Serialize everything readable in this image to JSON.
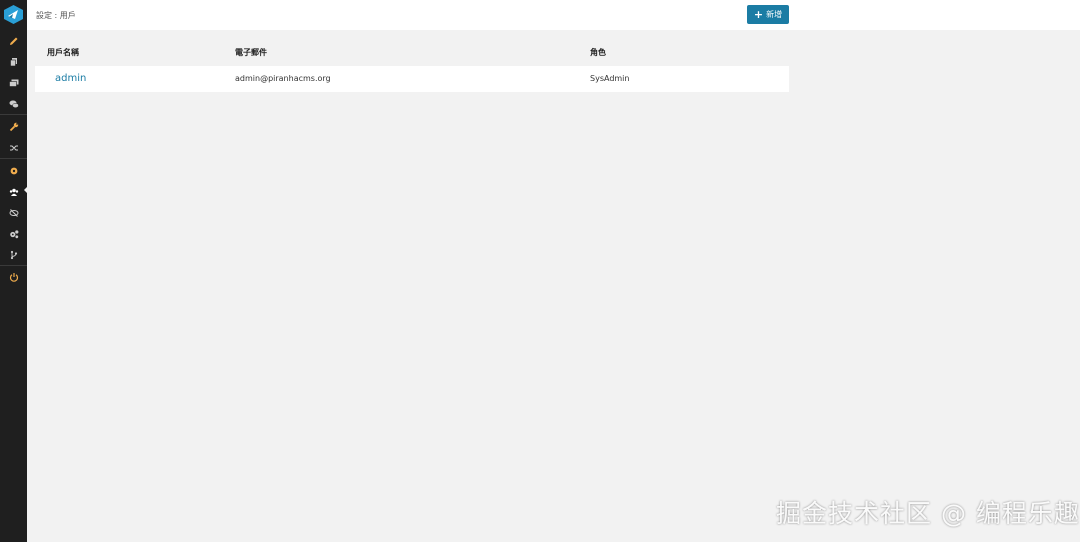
{
  "sidebar": {
    "logo_icon": "piranha-logo-icon",
    "items": [
      {
        "icon": "pencil-icon",
        "color": "#f0ad4e"
      },
      {
        "icon": "pages-icon",
        "color": "#cccccc"
      },
      {
        "icon": "media-icon",
        "color": "#cccccc"
      },
      {
        "icon": "comments-icon",
        "color": "#cccccc"
      },
      {
        "icon": "wrench-icon",
        "color": "#f0ad4e"
      },
      {
        "icon": "random-icon",
        "color": "#cccccc"
      },
      {
        "icon": "cog-icon",
        "color": "#f0ad4e"
      },
      {
        "icon": "users-icon",
        "color": "#ffffff",
        "active": true
      },
      {
        "icon": "eye-slash-icon",
        "color": "#cccccc"
      },
      {
        "icon": "cogs-icon",
        "color": "#cccccc"
      },
      {
        "icon": "code-branch-icon",
        "color": "#cccccc"
      },
      {
        "icon": "power-icon",
        "color": "#f0ad4e"
      }
    ]
  },
  "header": {
    "breadcrumb": "設定 : 用戶",
    "add_button_label": "新增",
    "add_button_icon": "plus-icon",
    "accent_color": "#1b7ca4"
  },
  "table": {
    "columns": [
      "用戶名稱",
      "電子郵件",
      "角色"
    ],
    "rows": [
      {
        "username": "admin",
        "email": "admin@piranhacms.org",
        "role": "SysAdmin"
      }
    ]
  },
  "watermark": "掘金技术社区 @ 编程乐趣"
}
